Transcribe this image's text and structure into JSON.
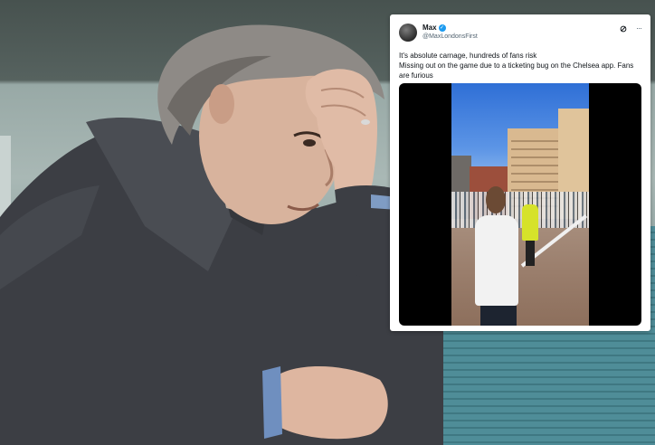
{
  "tweet": {
    "author_name": "Max",
    "author_handle": "@MaxLondonsFirst",
    "verified_icon": "verified-badge-icon",
    "grok_icon": "grok-icon",
    "more_icon": "more-options-icon",
    "more_glyph": "···",
    "text_line1": "It's absolute carnage, hundreds of fans risk",
    "text_line2": "Missing out on the game due to a ticketing bug on the Chelsea app. Fans are furious"
  },
  "colors": {
    "verified": "#1d9bf0",
    "tweet_background": "#ffffff",
    "text_primary": "#0f1419",
    "text_secondary": "#536471"
  }
}
